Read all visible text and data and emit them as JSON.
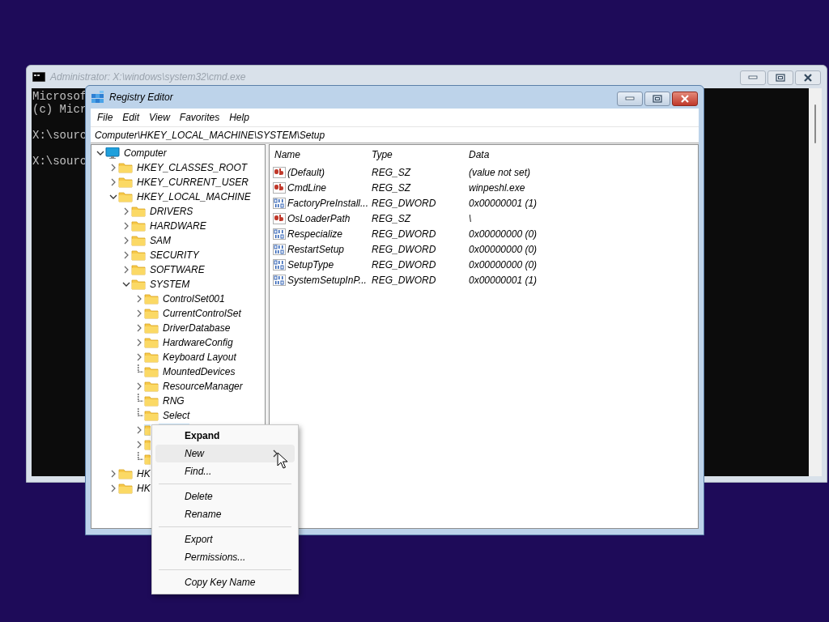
{
  "console_window": {
    "title": "Administrator: X:\\windows\\system32\\cmd.exe",
    "active": false,
    "paragraphs": [
      [
        "Microsof",
        "(c) Micr"
      ],
      [
        "X:\\sourc"
      ],
      [
        "X:\\sourc"
      ]
    ]
  },
  "registry_editor": {
    "title": "Registry Editor",
    "active": true,
    "menu": [
      "File",
      "Edit",
      "View",
      "Favorites",
      "Help"
    ],
    "address": "Computer\\HKEY_LOCAL_MACHINE\\SYSTEM\\Setup",
    "tree": [
      {
        "label": "Computer",
        "kind": "computer",
        "expandable": true,
        "expanded": true,
        "selected": false,
        "children": [
          {
            "label": "HKEY_CLASSES_ROOT",
            "kind": "key",
            "expandable": true,
            "expanded": false,
            "selected": false
          },
          {
            "label": "HKEY_CURRENT_USER",
            "kind": "key",
            "expandable": true,
            "expanded": false,
            "selected": false
          },
          {
            "label": "HKEY_LOCAL_MACHINE",
            "kind": "key",
            "expandable": true,
            "expanded": true,
            "selected": false,
            "children": [
              {
                "label": "DRIVERS",
                "kind": "key",
                "expandable": true,
                "expanded": false,
                "selected": false
              },
              {
                "label": "HARDWARE",
                "kind": "key",
                "expandable": true,
                "expanded": false,
                "selected": false
              },
              {
                "label": "SAM",
                "kind": "key",
                "expandable": true,
                "expanded": false,
                "selected": false
              },
              {
                "label": "SECURITY",
                "kind": "key",
                "expandable": true,
                "expanded": false,
                "selected": false
              },
              {
                "label": "SOFTWARE",
                "kind": "key",
                "expandable": true,
                "expanded": false,
                "selected": false
              },
              {
                "label": "SYSTEM",
                "kind": "key",
                "expandable": true,
                "expanded": true,
                "selected": false,
                "children": [
                  {
                    "label": "ControlSet001",
                    "kind": "key",
                    "expandable": true,
                    "expanded": false,
                    "selected": false
                  },
                  {
                    "label": "CurrentControlSet",
                    "kind": "key",
                    "expandable": true,
                    "expanded": false,
                    "selected": false
                  },
                  {
                    "label": "DriverDatabase",
                    "kind": "key",
                    "expandable": true,
                    "expanded": false,
                    "selected": false
                  },
                  {
                    "label": "HardwareConfig",
                    "kind": "key",
                    "expandable": true,
                    "expanded": false,
                    "selected": false
                  },
                  {
                    "label": "Keyboard Layout",
                    "kind": "key",
                    "expandable": true,
                    "expanded": false,
                    "selected": false
                  },
                  {
                    "label": "MountedDevices",
                    "kind": "key",
                    "expandable": false,
                    "selected": false
                  },
                  {
                    "label": "ResourceManager",
                    "kind": "key",
                    "expandable": true,
                    "expanded": false,
                    "selected": false
                  },
                  {
                    "label": "RNG",
                    "kind": "key",
                    "expandable": false,
                    "selected": false
                  },
                  {
                    "label": "Select",
                    "kind": "key",
                    "expandable": false,
                    "selected": false
                  },
                  {
                    "kind": "key",
                    "expandable": true,
                    "expanded": false,
                    "selected": true
                  },
                  {
                    "kind": "key",
                    "expandable": true,
                    "expanded": false,
                    "selected": false
                  },
                  {
                    "kind": "key",
                    "expandable": false,
                    "selected": false
                  }
                ]
              }
            ]
          },
          {
            "label": "HK",
            "kind": "key",
            "expandable": true,
            "expanded": false,
            "selected": false
          },
          {
            "label": "HK",
            "kind": "key",
            "expandable": true,
            "expanded": false,
            "selected": false
          }
        ]
      }
    ],
    "columns": [
      "Name",
      "Type",
      "Data"
    ],
    "values": [
      {
        "name": "(Default)",
        "type": "REG_SZ",
        "data": "(value not set)",
        "kind": "string"
      },
      {
        "name": "CmdLine",
        "type": "REG_SZ",
        "data": "winpeshl.exe",
        "kind": "string"
      },
      {
        "name": "FactoryPreInstall...",
        "type": "REG_DWORD",
        "data": "0x00000001 (1)",
        "kind": "binary"
      },
      {
        "name": "OsLoaderPath",
        "type": "REG_SZ",
        "data": "\\",
        "kind": "string"
      },
      {
        "name": "Respecialize",
        "type": "REG_DWORD",
        "data": "0x00000000 (0)",
        "kind": "binary"
      },
      {
        "name": "RestartSetup",
        "type": "REG_DWORD",
        "data": "0x00000000 (0)",
        "kind": "binary"
      },
      {
        "name": "SetupType",
        "type": "REG_DWORD",
        "data": "0x00000000 (0)",
        "kind": "binary"
      },
      {
        "name": "SystemSetupInP...",
        "type": "REG_DWORD",
        "data": "0x00000001 (1)",
        "kind": "binary"
      }
    ]
  },
  "context_menu": {
    "groups": [
      [
        {
          "label": "Expand",
          "default": true,
          "hovered": false,
          "submenu": false
        },
        {
          "label": "New",
          "default": false,
          "hovered": true,
          "submenu": true
        },
        {
          "label": "Find...",
          "default": false,
          "hovered": false,
          "submenu": false
        }
      ],
      [
        {
          "label": "Delete",
          "default": false,
          "hovered": false,
          "submenu": false
        },
        {
          "label": "Rename",
          "default": false,
          "hovered": false,
          "submenu": false
        }
      ],
      [
        {
          "label": "Export",
          "default": false,
          "hovered": false,
          "submenu": false
        },
        {
          "label": "Permissions...",
          "default": false,
          "hovered": false,
          "submenu": false
        }
      ],
      [
        {
          "label": "Copy Key Name",
          "default": false,
          "hovered": false,
          "submenu": false
        }
      ]
    ]
  }
}
